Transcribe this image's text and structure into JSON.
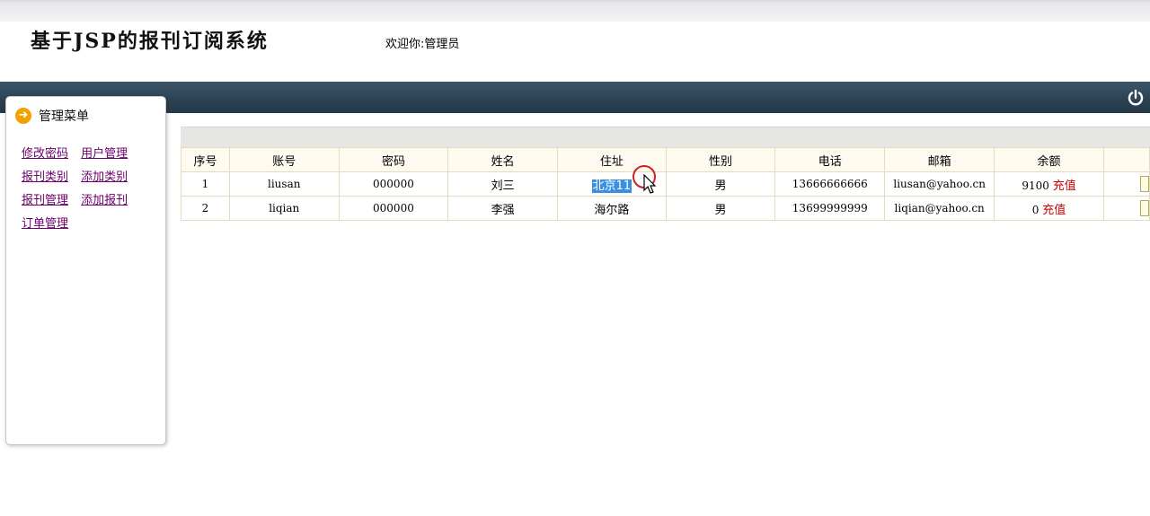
{
  "header": {
    "site_title": "基于JSP的报刊订阅系统",
    "welcome": "欢迎你:管理员"
  },
  "navbar": {
    "power_icon": "power-icon"
  },
  "sidebar": {
    "title": "管理菜单",
    "icon": "arrow-right-icon",
    "items": [
      {
        "label": "修改密码"
      },
      {
        "label": "用户管理"
      },
      {
        "label": "报刊类别"
      },
      {
        "label": "添加类别"
      },
      {
        "label": "报刊管理"
      },
      {
        "label": "添加报刊"
      },
      {
        "label": "订单管理"
      }
    ]
  },
  "table": {
    "headers": [
      "序号",
      "账号",
      "密码",
      "姓名",
      "住址",
      "性别",
      "电话",
      "邮箱",
      "余额"
    ],
    "recharge_label": "充值",
    "rows": [
      {
        "index": "1",
        "account": "liusan",
        "password": "000000",
        "name": "刘三",
        "address": "北京11",
        "gender": "男",
        "phone": "13666666666",
        "email": "liusan@yahoo.cn",
        "balance": "9100"
      },
      {
        "index": "2",
        "account": "liqian",
        "password": "000000",
        "name": "李强",
        "address": "海尔路",
        "gender": "男",
        "phone": "13699999999",
        "email": "liqian@yahoo.cn",
        "balance": "0"
      }
    ]
  },
  "colors": {
    "navbar": "#2c4354",
    "link": "#6a006a",
    "recharge": "#cc0000",
    "selection": "#3b8fe0"
  }
}
